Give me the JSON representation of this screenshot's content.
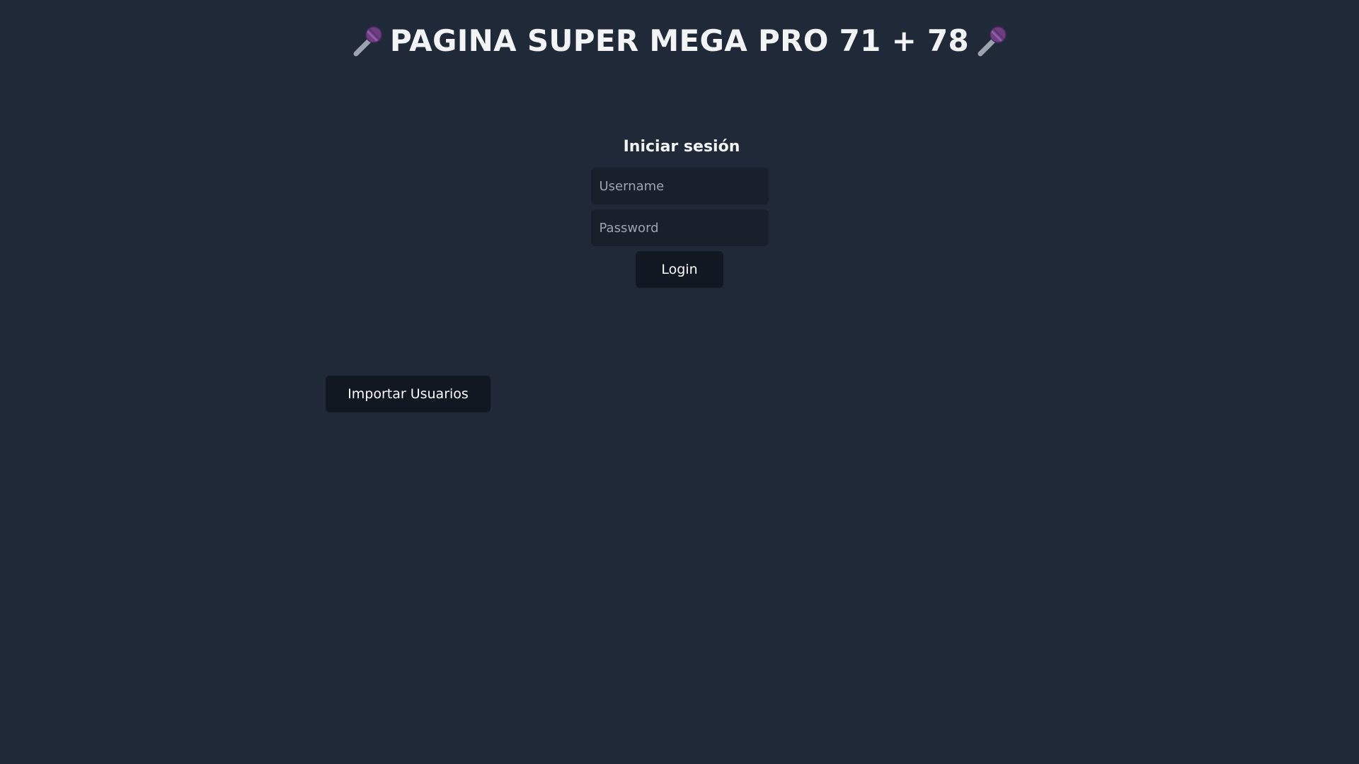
{
  "header": {
    "title": "PAGINA SUPER MEGA PRO 71 + 78",
    "left_icon": "microphone-icon",
    "right_icon": "microphone-icon"
  },
  "login": {
    "heading": "Iniciar sesión",
    "username_placeholder": "Username",
    "username_value": "",
    "password_placeholder": "Password",
    "password_value": "",
    "button_label": "Login"
  },
  "actions": {
    "import_label": "Importar Usuarios"
  },
  "colors": {
    "background": "#1f2937",
    "input_background": "#18202b",
    "button_background": "#111821",
    "mic_head": "#7b4a8f",
    "mic_handle": "#9ca3af"
  }
}
